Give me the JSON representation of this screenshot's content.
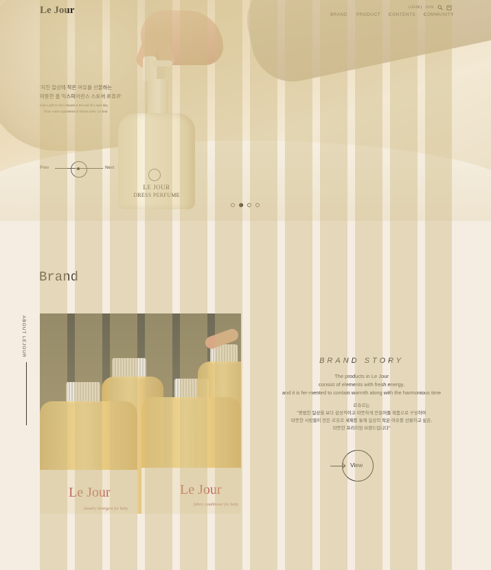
{
  "header": {
    "logo": "Le Jour",
    "login": "LOGIN",
    "join": "JOIN",
    "menu": [
      "BRAND",
      "PRODUCT",
      "CONTENTS",
      "COMMUNITY"
    ],
    "icons": [
      "search-icon",
      "cart-icon"
    ]
  },
  "hero": {
    "headline_kr_1": "'지친 일상에 작은 여유를 선물하는",
    "headline_kr_2": "따뜻한 홈 익스피어런스 스토어 르쥬르'",
    "sub_en_1": "Like a gift to feel relaxed at the end of a hard day,",
    "sub_en_2": "Your warm experience of Home store, Le Jour",
    "prev": "Prev",
    "next": "Next",
    "slides": 4,
    "active_slide": 2,
    "bottle_brand": "LE JOUR",
    "bottle_product": "DRESS PERFUME"
  },
  "brand": {
    "title": "Brand",
    "side_label": "ABOUT LEJOUR",
    "photo_label_1": "Le Jour",
    "photo_sub_1": "laundry detergent for baby",
    "photo_label_2": "Le Jour",
    "photo_sub_2": "fabric conditioner for baby",
    "story_title": "BRAND STORY",
    "story_en_1": "The products in  Le Jour",
    "story_en_2": "consist of elements with fresh energy,",
    "story_en_3": "and it is fer-mented to contain warmth along with the harmonious time",
    "story_kr_1": "르쥬르는",
    "story_kr_2": "\"평범한 일상을 보다 감성적이고 따뜻하게 만들어줄 제품으로 구성하여",
    "story_kr_3": "따뜻한 사람들이 만든 르쥬르 세제를 통해 일상의 작은 여유를 선물하고 싶은,",
    "story_kr_4": "따뜻한 프리미엄 브랜드입니다\"",
    "view": "View"
  },
  "colors": {
    "page_bg": "#f5ede2",
    "stripe": "#cdb982",
    "text": "#3a3530"
  }
}
